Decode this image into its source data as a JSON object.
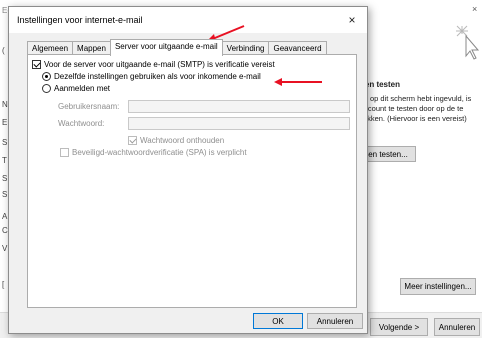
{
  "background": {
    "title": "E-m",
    "close_glyph": "×",
    "sidebar_letters": [
      "(",
      "N",
      "E",
      "S",
      "T",
      "S",
      "S",
      "A",
      "C",
      "V",
      "["
    ],
    "panel_heading": "gen testen",
    "panel_text": "ns op dit scherm hebt ingevuld, is account te testen door op de te klikken. (Hiervoor is een vereist)",
    "test_button": "en testen...",
    "more_settings_button": "Meer instellingen...",
    "next_button": "Volgende >",
    "cancel_button": "Annuleren"
  },
  "dialog": {
    "title": "Instellingen voor internet-e-mail",
    "close_glyph": "×",
    "tabs": [
      {
        "label": "Algemeen"
      },
      {
        "label": "Mappen"
      },
      {
        "label": "Server voor uitgaande e-mail"
      },
      {
        "label": "Verbinding"
      },
      {
        "label": "Geavanceerd"
      }
    ],
    "active_tab": "Server voor uitgaande e-mail",
    "smtp_auth_label": "Voor de server voor uitgaande e-mail (SMTP) is verificatie vereist",
    "same_settings_label": "Dezelfde instellingen gebruiken als voor inkomende e-mail",
    "login_label": "Aanmelden met",
    "username_label": "Gebruikersnaam:",
    "username_value": "",
    "password_label": "Wachtwoord:",
    "password_value": "",
    "remember_password_label": "Wachtwoord onthouden",
    "spa_label": "Beveiligd-wachtwoordverificatie (SPA) is verplicht",
    "ok_button": "OK",
    "cancel_button": "Annuleren"
  },
  "annotation_color": "#e81123"
}
